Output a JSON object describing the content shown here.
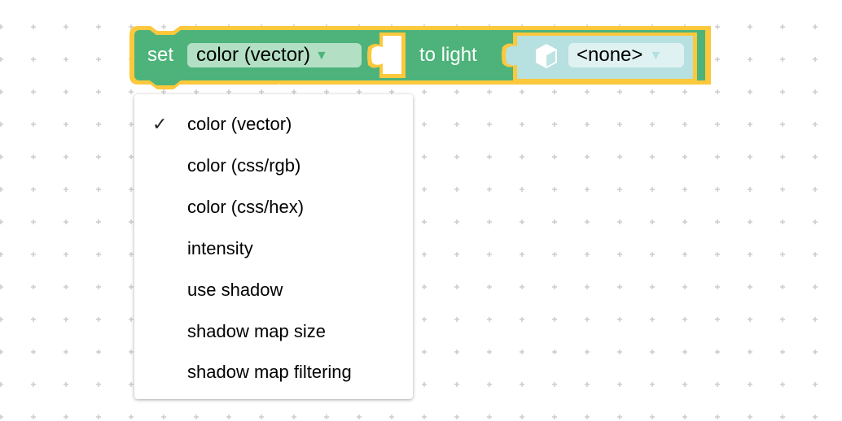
{
  "block": {
    "prefix": "set",
    "property_dropdown": {
      "selected": "color (vector)",
      "arrow": "▼"
    },
    "middle_text": "to light",
    "light_input": {
      "icon": "cube-icon",
      "dropdown": {
        "selected": "<none>",
        "arrow": "▼"
      }
    }
  },
  "menu": {
    "items": [
      {
        "label": "color (vector)",
        "checked": true,
        "check_glyph": "✓"
      },
      {
        "label": "color (css/rgb)",
        "checked": false
      },
      {
        "label": "color (css/hex)",
        "checked": false
      },
      {
        "label": "intensity",
        "checked": false
      },
      {
        "label": "use shadow",
        "checked": false
      },
      {
        "label": "shadow map size",
        "checked": false
      },
      {
        "label": "shadow map filtering",
        "checked": false
      }
    ]
  },
  "colors": {
    "block_green": "#4db37a",
    "highlight_yellow": "#fcc83c",
    "field_green": "#b3e0c4",
    "light_block": "#b7e0e0",
    "field_light": "#dff1f1",
    "grid": "#cccccc"
  }
}
